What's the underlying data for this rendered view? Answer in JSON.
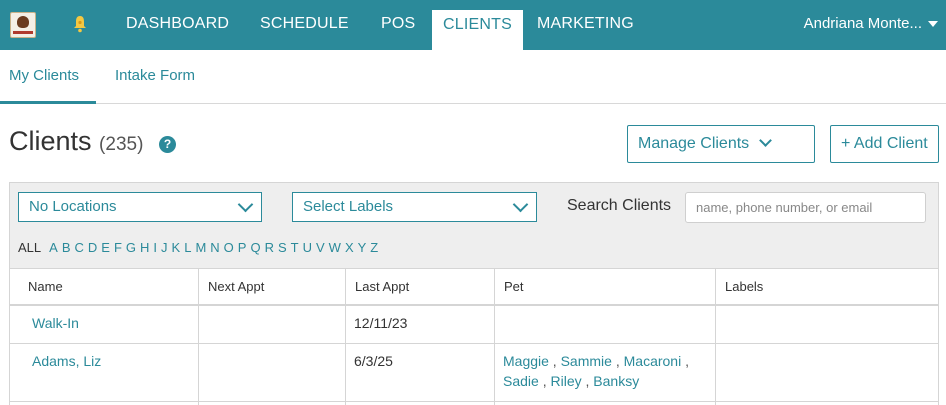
{
  "nav": {
    "items": [
      {
        "label": "DASHBOARD"
      },
      {
        "label": "SCHEDULE"
      },
      {
        "label": "POS"
      },
      {
        "label": "CLIENTS"
      },
      {
        "label": "MARKETING"
      }
    ],
    "active": "CLIENTS",
    "user": "Andriana Monte..."
  },
  "subtabs": [
    {
      "label": "My Clients",
      "active": true
    },
    {
      "label": "Intake Form",
      "active": false
    }
  ],
  "header": {
    "title": "Clients",
    "count": "(235)",
    "help_icon": "?",
    "manage_label": "Manage Clients",
    "add_label": "+ Add Client"
  },
  "filters": {
    "location": "No Locations",
    "labels": "Select Labels",
    "search_label": "Search Clients",
    "search_placeholder": "name, phone number, or email",
    "alpha": [
      "ALL",
      "A",
      "B",
      "C",
      "D",
      "E",
      "F",
      "G",
      "H",
      "I",
      "J",
      "K",
      "L",
      "M",
      "N",
      "O",
      "P",
      "Q",
      "R",
      "S",
      "T",
      "U",
      "V",
      "W",
      "X",
      "Y",
      "Z"
    ]
  },
  "table": {
    "columns": [
      "Name",
      "Next Appt",
      "Last Appt",
      "Pet",
      "Labels"
    ],
    "rows": [
      {
        "name": "Walk-In",
        "next": "",
        "last": "12/11/23",
        "pets": [],
        "labels": ""
      },
      {
        "name": "Adams, Liz",
        "next": "",
        "last": "6/3/25",
        "pets": [
          "Maggie",
          "Sammie",
          "Macaroni",
          "Sadie",
          "Riley",
          "Banksy"
        ],
        "labels": ""
      }
    ]
  },
  "colors": {
    "primary": "#2b8a9a",
    "panel_bg": "#eeeeee"
  }
}
